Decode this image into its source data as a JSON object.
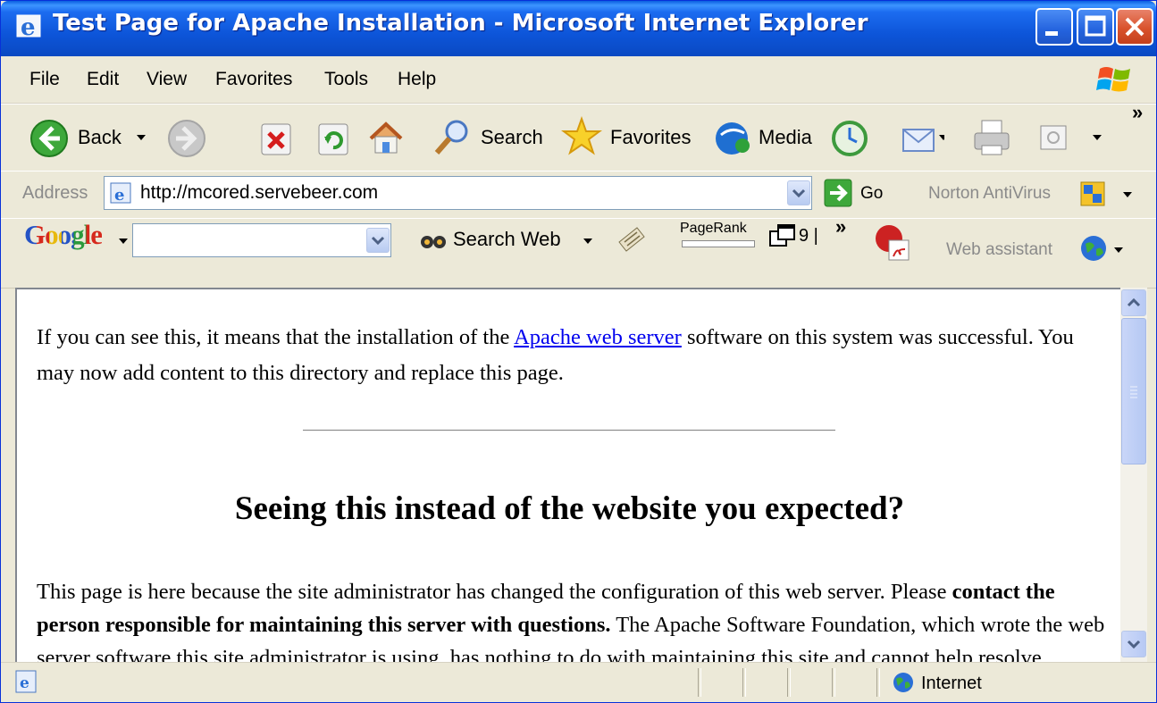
{
  "window": {
    "title": "Test Page for Apache Installation - Microsoft Internet Explorer"
  },
  "menu": {
    "items": [
      "File",
      "Edit",
      "View",
      "Favorites",
      "Tools",
      "Help"
    ]
  },
  "toolbar": {
    "back_label": "Back",
    "search_label": "Search",
    "favorites_label": "Favorites",
    "media_label": "Media",
    "more_label": "»"
  },
  "address_bar": {
    "label": "Address",
    "url": "http://mcored.servebeer.com",
    "go_label": "Go",
    "norton_label": "Norton AntiVirus"
  },
  "google_bar": {
    "logo": "Google",
    "search_value": "",
    "search_web_label": "Search Web",
    "pagerank_label": "PageRank",
    "blocked_count": "9 |",
    "more_label": "»",
    "web_assistant_label": "Web assistant"
  },
  "page": {
    "para1_before": "If you can see this, it means that the installation of the ",
    "para1_link": "Apache web server",
    "para1_after": " software on this system was successful. You may now add content to this directory and replace this page.",
    "heading": "Seeing this instead of the website you expected?",
    "para2_before": "This page is here because the site administrator has changed the configuration of this web server. Please ",
    "para2_bold": "contact the person responsible for maintaining this server with questions.",
    "para2_after": " The Apache Software Foundation, which wrote the web server software this site administrator is using, has nothing to do with maintaining this site and cannot help resolve configuration issues."
  },
  "status": {
    "zone_label": "Internet"
  },
  "icons": {
    "back": "back-arrow-icon",
    "forward": "forward-arrow-icon",
    "stop": "stop-icon",
    "refresh": "refresh-icon",
    "home": "home-icon",
    "search": "search-icon",
    "favorites": "favorites-star-icon",
    "media": "media-icon",
    "history": "history-icon",
    "mail": "mail-icon",
    "print": "print-icon",
    "edit": "edit-icon"
  }
}
